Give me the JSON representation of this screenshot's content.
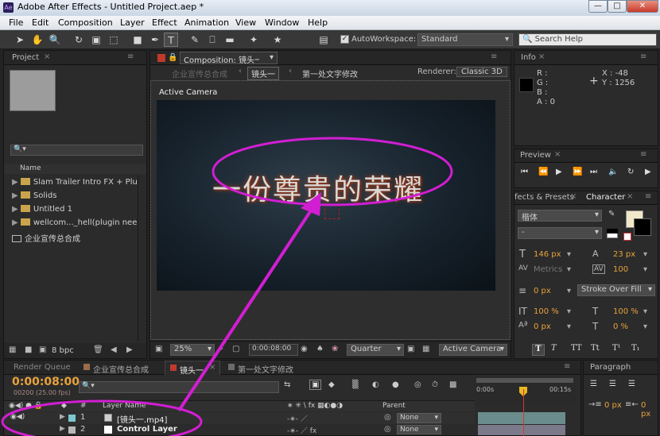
{
  "app": {
    "title": "Adobe After Effects - Untitled Project.aep *",
    "menus": [
      "File",
      "Edit",
      "Composition",
      "Layer",
      "Effect",
      "Animation",
      "View",
      "Window",
      "Help"
    ],
    "window_buttons": [
      "—",
      "□",
      "✕"
    ]
  },
  "toolbar": {
    "auto_workspace_label": "AutoWorkspace:",
    "workspace_value": "Standard",
    "search_placeholder": "Search Help"
  },
  "project": {
    "tab_label": "Project",
    "col_name": "Name",
    "items": [
      {
        "label": "Slam Trailer Intro FX + Plug-in",
        "type": "folder"
      },
      {
        "label": "Solids",
        "type": "folder"
      },
      {
        "label": "Untitled 1",
        "type": "folder"
      },
      {
        "label": "wellcom..._hell(plugin needed",
        "type": "folder"
      },
      {
        "label": "企业宣传总合成",
        "type": "comp"
      }
    ],
    "bpc_label": "8 bpc"
  },
  "composition": {
    "tab_label": "Composition: 镜头一",
    "breadcrumbs": [
      "企业宣传总合成",
      "镜头一",
      "第一处文字修改"
    ],
    "renderer_label": "Renderer:",
    "renderer_value": "Classic 3D",
    "view_label": "Active Camera",
    "canvas_text": "一份尊贵的荣耀",
    "zoom": "25%",
    "timecode": "0:00:08:00",
    "resolution": "Quarter",
    "camera": "Active Camera",
    "annotation_color": "#d21ed2"
  },
  "info": {
    "tab_label": "Info",
    "r_label": "R :",
    "g_label": "G :",
    "b_label": "B :",
    "a_label": "A : 0",
    "x_label": "X : -48",
    "y_label": "Y : 1256"
  },
  "preview": {
    "tab_label": "Preview"
  },
  "effects": {
    "tab_label": "fects & Presets"
  },
  "character": {
    "tab_label": "Character",
    "font": "楷体",
    "style": "-",
    "font_size": "146 px",
    "leading": "23 px",
    "kerning": "Metrics",
    "tracking": "100",
    "stroke_width": "0 px",
    "stroke_mode": "Stroke Over Fill",
    "vscale": "100 %",
    "hscale": "100 %",
    "baseline": "0 px",
    "tsume": "0 %",
    "style_buttons": [
      "T",
      "T",
      "TT",
      "Tt",
      "T¹",
      "T₁"
    ]
  },
  "paragraph": {
    "tab_label": "Paragraph",
    "indent1": "0 px",
    "indent2": "0 px"
  },
  "timeline": {
    "tabs": [
      "Render Queue",
      "企业宣传总合成",
      "镜头一",
      "第一处文字修改"
    ],
    "timecode": "0:00:08:00",
    "frame_info": "00200 (25.00 fps)",
    "col_layer_name": "Layer Name",
    "col_parent": "Parent",
    "col_num": "#",
    "ruler_start": "0:00s",
    "ruler_end": "00:15s",
    "layers": [
      {
        "num": "1",
        "name": "[镜头一.mp4]",
        "parent": "None"
      },
      {
        "num": "2",
        "name": "Control Layer",
        "parent": "None"
      }
    ]
  }
}
